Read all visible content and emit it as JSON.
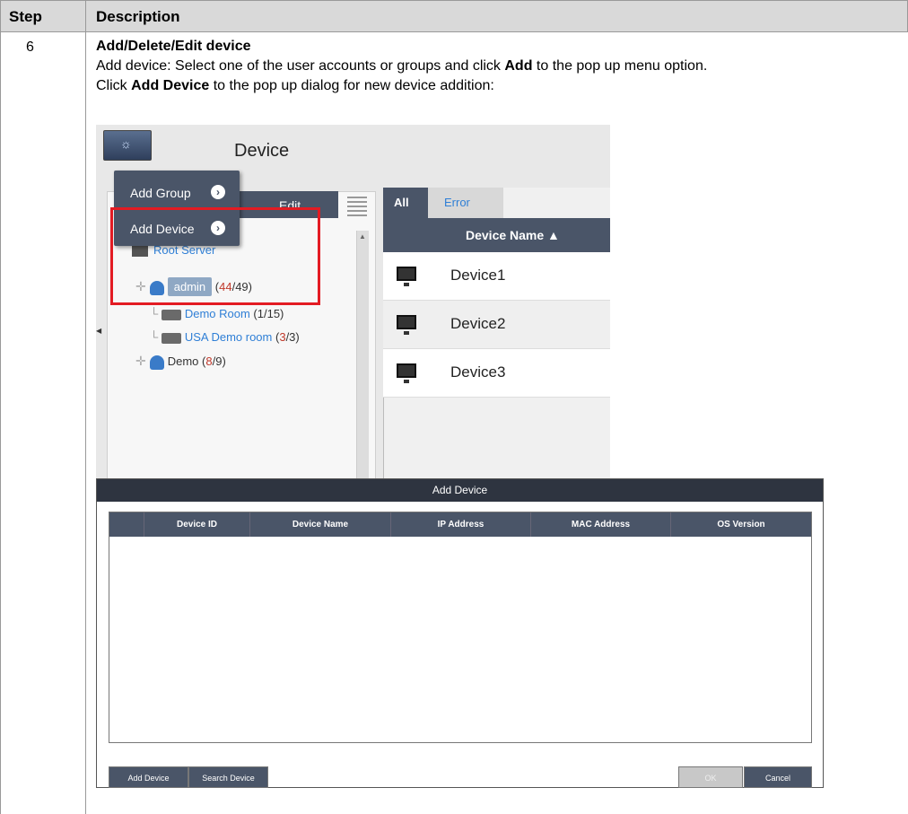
{
  "table": {
    "header_step": "Step",
    "header_description": "Description",
    "step_number": "6",
    "title": "Add/Delete/Edit device",
    "line1_pre": "Add device: Select one of the user accounts or groups and click ",
    "line1_bold": "Add",
    "line1_post": " to the pop up menu option.",
    "line2_pre": "Click ",
    "line2_bold": "Add Device",
    "line2_post": " to the pop up dialog for new device addition:"
  },
  "screenshot": {
    "window_title": "Device",
    "edit_label": "Edit",
    "popup_items": [
      "Add Group",
      "Add Device"
    ],
    "tree": {
      "root": "Root Server",
      "admin_label": "admin",
      "admin_count_red": "44",
      "admin_count_total": "/49)",
      "demo_room": "Demo Room",
      "demo_room_count": "(1/15)",
      "usa_room": "USA Demo room",
      "usa_room_count_red": "3",
      "usa_room_count_total": "/3)",
      "demo_label": "Demo",
      "demo_count_red": "8",
      "demo_count_total": "/9)"
    },
    "tabs": [
      "All",
      "Error"
    ],
    "column_header": "Device Name ▲",
    "devices": [
      "Device1",
      "Device2",
      "Device3"
    ]
  },
  "dialog": {
    "title": "Add Device",
    "columns": [
      "Device ID",
      "Device Name",
      "IP Address",
      "MAC Address",
      "OS Version"
    ],
    "buttons": {
      "add_device": "Add Device",
      "search_device": "Search Device",
      "ok": "OK",
      "cancel": "Cancel"
    }
  },
  "colors": {
    "highlight_red": "#e31b23",
    "panel_dark": "#4a5568",
    "link_blue": "#2f7fd6",
    "count_red": "#c0392b"
  }
}
